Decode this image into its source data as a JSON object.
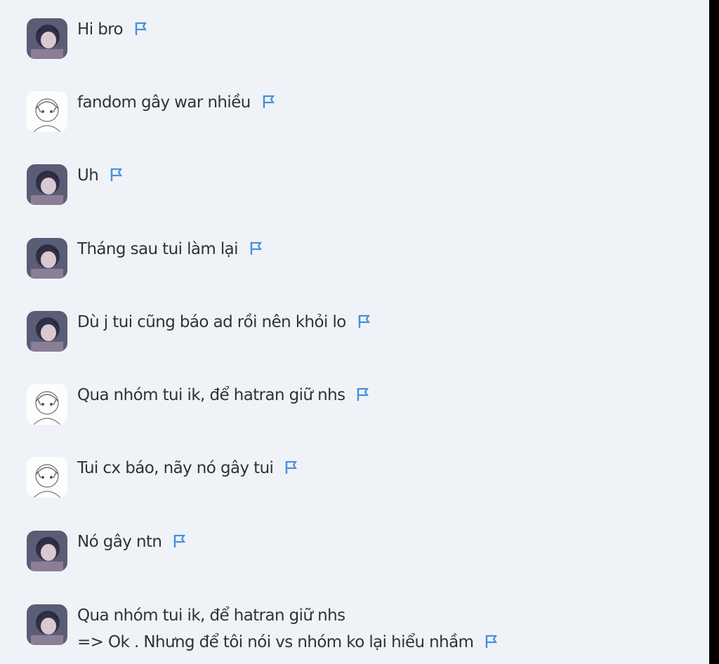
{
  "messages": [
    {
      "avatar": "dark-avatar",
      "lines": [
        "Hi bro"
      ]
    },
    {
      "avatar": "sketch-avatar",
      "lines": [
        "fandom gây war nhiều"
      ]
    },
    {
      "avatar": "dark-avatar",
      "lines": [
        "Uh"
      ]
    },
    {
      "avatar": "dark-avatar",
      "lines": [
        "Tháng sau tui làm lại"
      ]
    },
    {
      "avatar": "dark-avatar",
      "lines": [
        "Dù j tui cũng báo ad rồi nên khỏi lo"
      ]
    },
    {
      "avatar": "sketch-avatar",
      "lines": [
        "Qua nhóm tui ik, để hatran giữ nhs"
      ]
    },
    {
      "avatar": "sketch-avatar",
      "lines": [
        "Tui cx báo, nãy nó gây tui"
      ]
    },
    {
      "avatar": "dark-avatar",
      "lines": [
        "Nó gây ntn"
      ]
    },
    {
      "avatar": "dark-avatar",
      "lines": [
        "Qua nhóm tui ik, để hatran giữ nhs",
        "=> Ok . Nhưng để tôi nói vs nhóm ko lại hiểu nhầm"
      ]
    }
  ],
  "icons": {
    "report": "flag-icon"
  },
  "colors": {
    "background": "#eff3f8",
    "text": "#2f3337",
    "flag": "#4a90d9"
  }
}
